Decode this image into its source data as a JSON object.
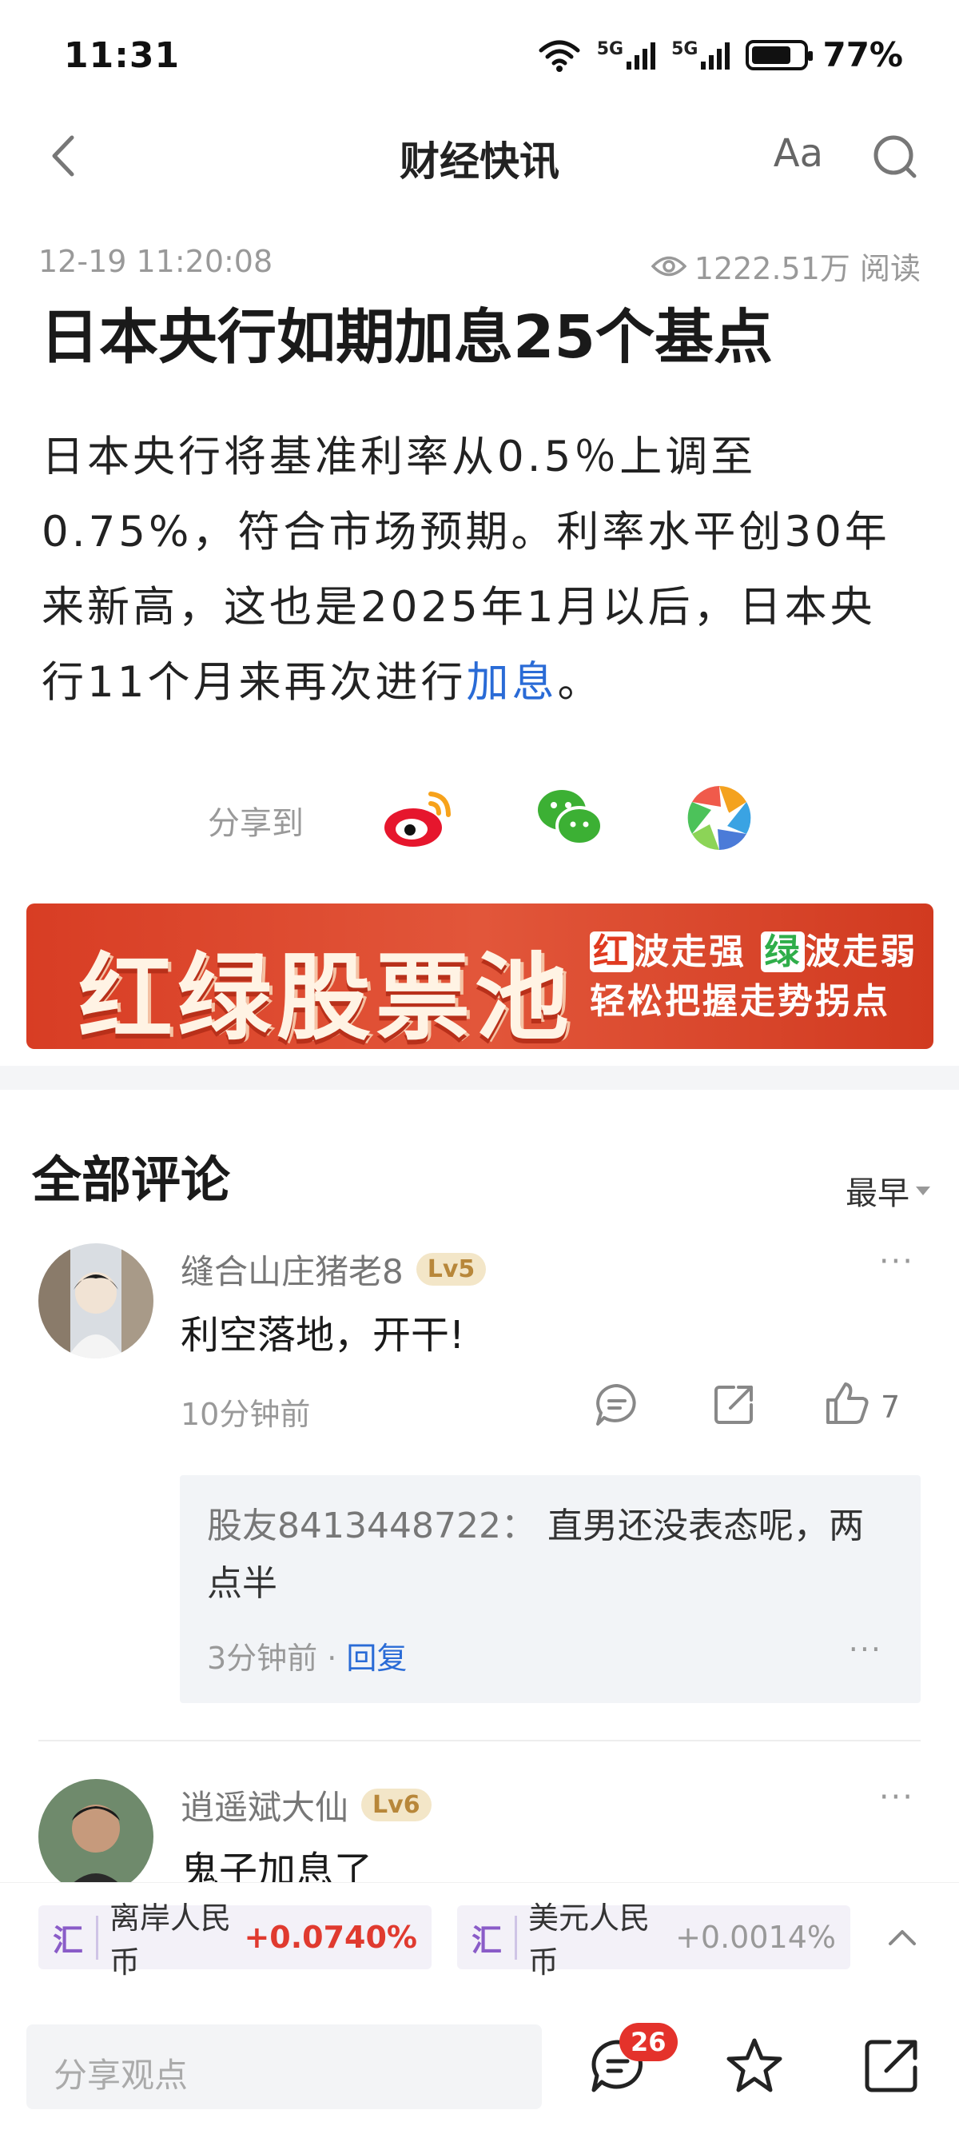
{
  "status_bar": {
    "time": "11:31",
    "network_1": "5G",
    "network_2": "5G",
    "battery_percent": 77,
    "battery_text": "77%"
  },
  "nav": {
    "title": "财经快讯",
    "font_label": "Aa"
  },
  "article": {
    "datetime": "12-19 11:20:08",
    "reads": "1222.51万 阅读",
    "headline": "日本央行如期加息25个基点",
    "body_before": "日本央行将基准利率从0.5％上调至0.75%，符合市场预期。利率水平创30年来新高，这也是2025年1月以后，日本央行11个月来再次进行",
    "body_link": "加息",
    "body_after": "。"
  },
  "share": {
    "label": "分享到",
    "targets": [
      "weibo-icon",
      "wechat-icon",
      "moments-icon"
    ]
  },
  "banner": {
    "big_text": "红绿股票池",
    "line1_red": "红",
    "line1_a": "波走强",
    "line1_green": "绿",
    "line1_b": "波走弱",
    "line2": "轻松把握走势拐点"
  },
  "comments": {
    "title": "全部评论",
    "sort_label": "最早",
    "items": [
      {
        "user": "缝合山庄猪老8",
        "level": "Lv5",
        "text": "利空落地，开干!",
        "time": "10分钟前",
        "likes": "7",
        "reply": {
          "user": "股友8413448722：",
          "text": "直男还没表态呢，两点半",
          "time": "3分钟前 · ",
          "action": "回复"
        }
      },
      {
        "user": "逍遥斌大仙",
        "level": "Lv6",
        "text": "鬼子加息了"
      }
    ]
  },
  "tickers": [
    {
      "tag": "汇",
      "name": "离岸人民币",
      "change": "+0.0740%"
    },
    {
      "tag": "汇",
      "name": "美元人民币",
      "change": "+0.0014%"
    }
  ],
  "bottom_bar": {
    "input_placeholder": "分享观点",
    "comment_count": "26"
  },
  "colors": {
    "accent_blue": "#2a6bd6",
    "up_red": "#e03a2f",
    "banner_red": "#d83d24"
  }
}
